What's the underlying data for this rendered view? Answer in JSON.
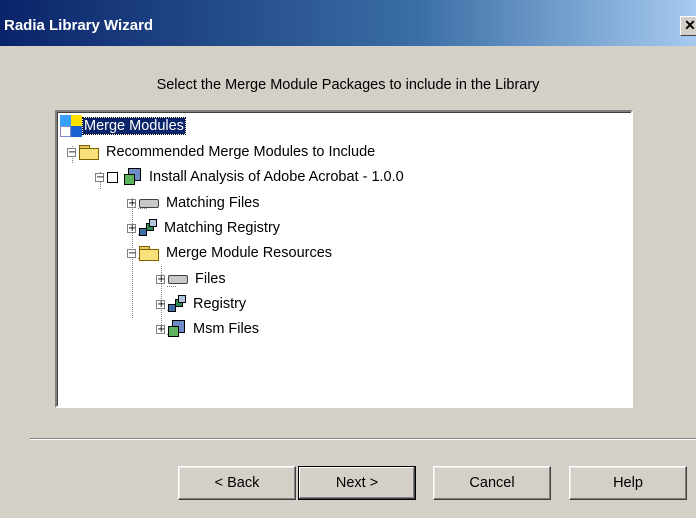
{
  "window": {
    "title": "Radia Library Wizard",
    "close_label": "✕"
  },
  "instruction": "Select the Merge Module Packages to include in the Library",
  "tree": {
    "root": "Merge Modules",
    "recommended": "Recommended Merge Modules to Include",
    "package": "Install Analysis of Adobe Acrobat - 1.0.0",
    "matching_files": "Matching Files",
    "matching_registry": "Matching Registry",
    "resources": "Merge Module Resources",
    "files": "Files",
    "registry": "Registry",
    "msm_files": "Msm Files",
    "collapse_symbol": "−",
    "expand_symbol": "+"
  },
  "buttons": {
    "back": "< Back",
    "next": "Next >",
    "cancel": "Cancel",
    "help": "Help"
  },
  "colors": {
    "titlebar": "#0a246a",
    "face": "#d4d0c8",
    "selection": "#0a246a"
  }
}
